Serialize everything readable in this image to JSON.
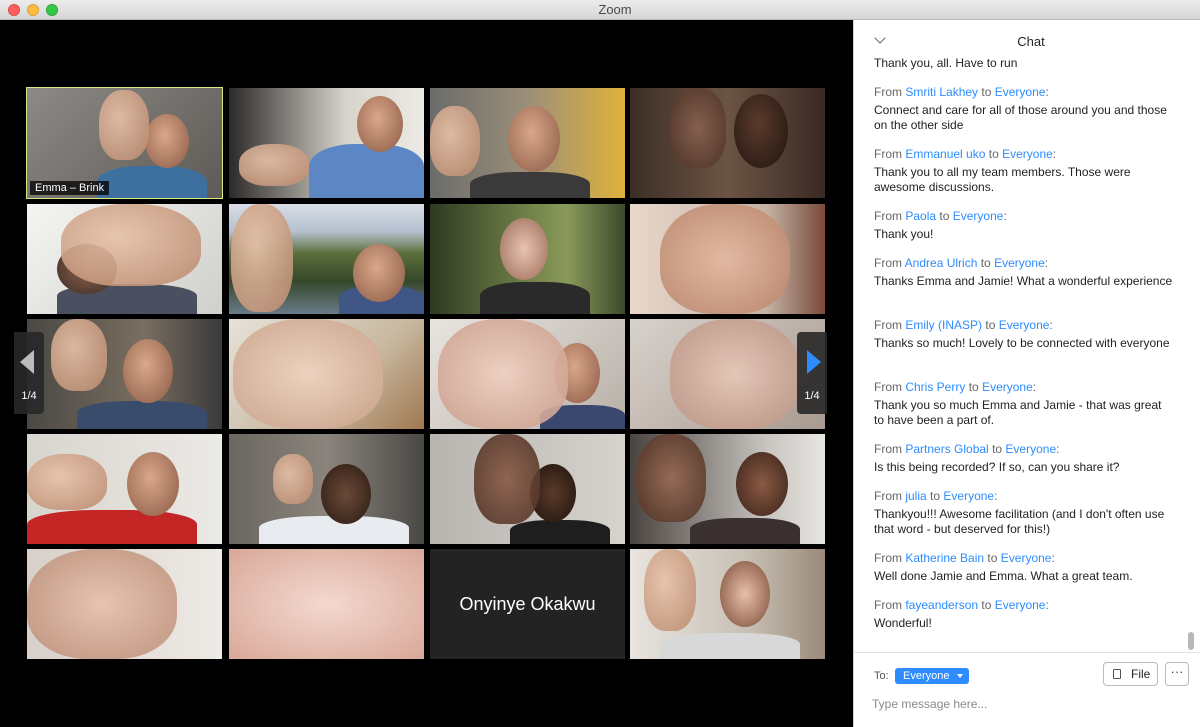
{
  "window": {
    "title": "Zoom",
    "colors": {
      "close": "#fc605c",
      "minimize": "#fdbc40",
      "maximize": "#34c749"
    }
  },
  "gallery": {
    "page_left": "1/4",
    "page_right": "1/4",
    "active_tile_color": "#d7e784",
    "tiles": [
      {
        "label": "Emma – Brink",
        "active": true
      },
      {
        "label": ""
      },
      {
        "label": ""
      },
      {
        "label": ""
      },
      {
        "label": ""
      },
      {
        "label": ""
      },
      {
        "label": ""
      },
      {
        "label": ""
      },
      {
        "label": ""
      },
      {
        "label": ""
      },
      {
        "label": ""
      },
      {
        "label": ""
      },
      {
        "label": ""
      },
      {
        "label": ""
      },
      {
        "label": ""
      },
      {
        "label": ""
      },
      {
        "label": ""
      },
      {
        "label": ""
      },
      {
        "label": "Onyinye Okakwu",
        "video_off": true
      },
      {
        "label": ""
      }
    ]
  },
  "chat": {
    "title": "Chat",
    "partial_top_message": "Thank you, all. Have to run",
    "accent": "#2d8cff",
    "from_word": "From",
    "to_word": "to",
    "messages": [
      {
        "sender": "Smriti Lakhey",
        "recipient": "Everyone",
        "text": "Connect and care for all of those around you and those on the other side"
      },
      {
        "sender": "Emmanuel uko",
        "recipient": "Everyone",
        "text": "Thank you to all my team members. Those were awesome discussions."
      },
      {
        "sender": "Paola",
        "recipient": "Everyone",
        "text": "Thank you!"
      },
      {
        "sender": "Andrea Ulrich",
        "recipient": "Everyone",
        "text": "Thanks Emma and Jamie! What a wonderful experience"
      },
      {
        "sender": "Emily (INASP)",
        "recipient": "Everyone",
        "text": "Thanks so much! Lovely to be connected with everyone"
      },
      {
        "sender": "Chris Perry",
        "recipient": "Everyone",
        "text": "Thank you so much Emma and Jamie - that was great to have been a part of."
      },
      {
        "sender": "Partners Global",
        "recipient": "Everyone",
        "text": "Is this being recorded? If so, can you share it?"
      },
      {
        "sender": "julia",
        "recipient": "Everyone",
        "text": "Thankyou!!! Awesome facilitation (and I don't often use that word - but deserved for this!)"
      },
      {
        "sender": "Katherine Bain",
        "recipient": "Everyone",
        "text": "Well done Jamie and Emma. What a great team."
      },
      {
        "sender": "fayeanderson",
        "recipient": "Everyone",
        "text": "Wonderful!"
      }
    ],
    "footer": {
      "to_label": "To:",
      "recipient_selected": "Everyone",
      "file_label": "File",
      "more_label": "···",
      "input_placeholder": "Type message here..."
    }
  }
}
